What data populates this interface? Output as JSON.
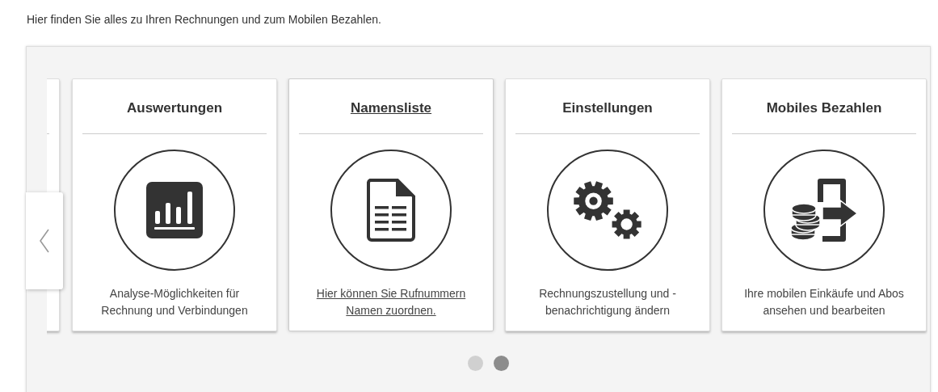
{
  "intro": "Hier finden Sie alles zu Ihren Rechnungen und zum Mobilen Bezahlen.",
  "cards": [
    {
      "title": "Auswertungen",
      "kind": "chart",
      "description": "Analyse-Möglichkeiten für Rechnung und Verbindungen",
      "hovered": false
    },
    {
      "title": "Namensliste",
      "kind": "document",
      "description": "Hier können Sie Rufnummern Namen zuordnen.",
      "hovered": true
    },
    {
      "title": "Einstellungen",
      "kind": "gears",
      "description": "Rechnungszustellung und -benachrichtigung ändern",
      "hovered": false
    },
    {
      "title": "Mobiles Bezahlen",
      "kind": "mobile-payment",
      "description": "Ihre mobilen Einkäufe und Abos ansehen und bearbeiten",
      "hovered": false
    }
  ],
  "pager": [
    {
      "selected": false
    },
    {
      "selected": true
    }
  ]
}
